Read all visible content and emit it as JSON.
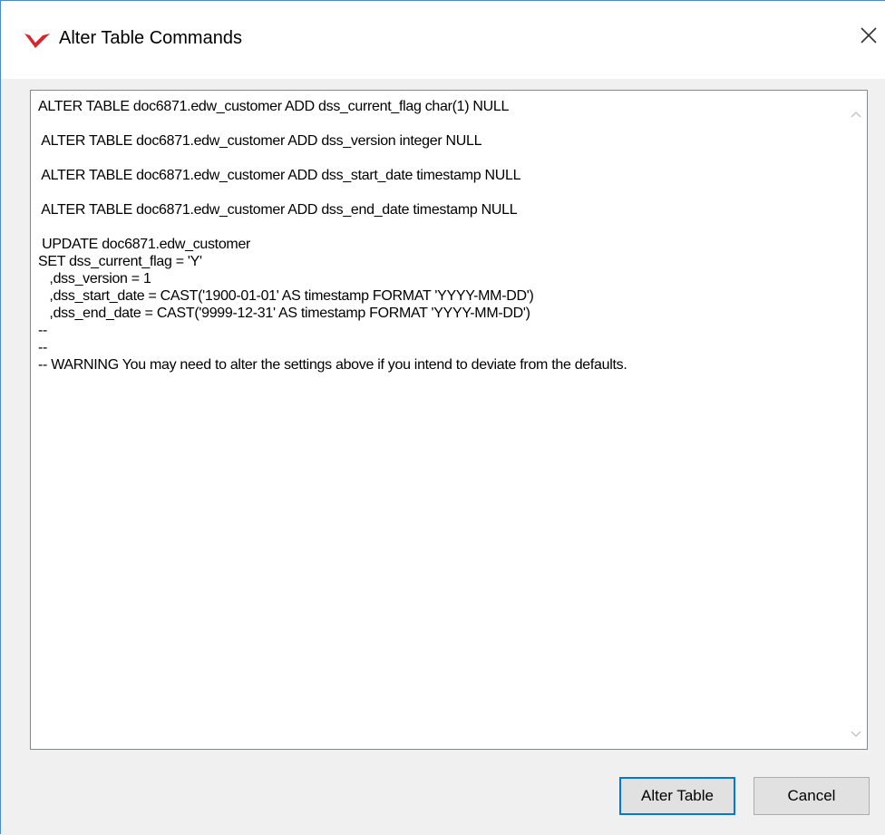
{
  "window": {
    "title": "Alter Table Commands",
    "close_label": "Close"
  },
  "editor": {
    "text": "ALTER TABLE doc6871.edw_customer ADD dss_current_flag char(1) NULL\n\n ALTER TABLE doc6871.edw_customer ADD dss_version integer NULL\n\n ALTER TABLE doc6871.edw_customer ADD dss_start_date timestamp NULL\n\n ALTER TABLE doc6871.edw_customer ADD dss_end_date timestamp NULL\n\n UPDATE doc6871.edw_customer\nSET dss_current_flag = 'Y'\n   ,dss_version = 1\n   ,dss_start_date = CAST('1900-01-01' AS timestamp FORMAT 'YYYY-MM-DD')\n   ,dss_end_date = CAST('9999-12-31' AS timestamp FORMAT 'YYYY-MM-DD')\n--\n--\n-- WARNING You may need to alter the settings above if you intend to deviate from the defaults."
  },
  "buttons": {
    "alter_table": "Alter Table",
    "cancel": "Cancel"
  },
  "colors": {
    "accent": "#0078d7",
    "icon_red": "#d9262e"
  },
  "icons": {
    "app": "wherescape-logo-icon",
    "close": "close-icon",
    "scroll_up": "chevron-up-icon",
    "scroll_down": "chevron-down-icon"
  }
}
